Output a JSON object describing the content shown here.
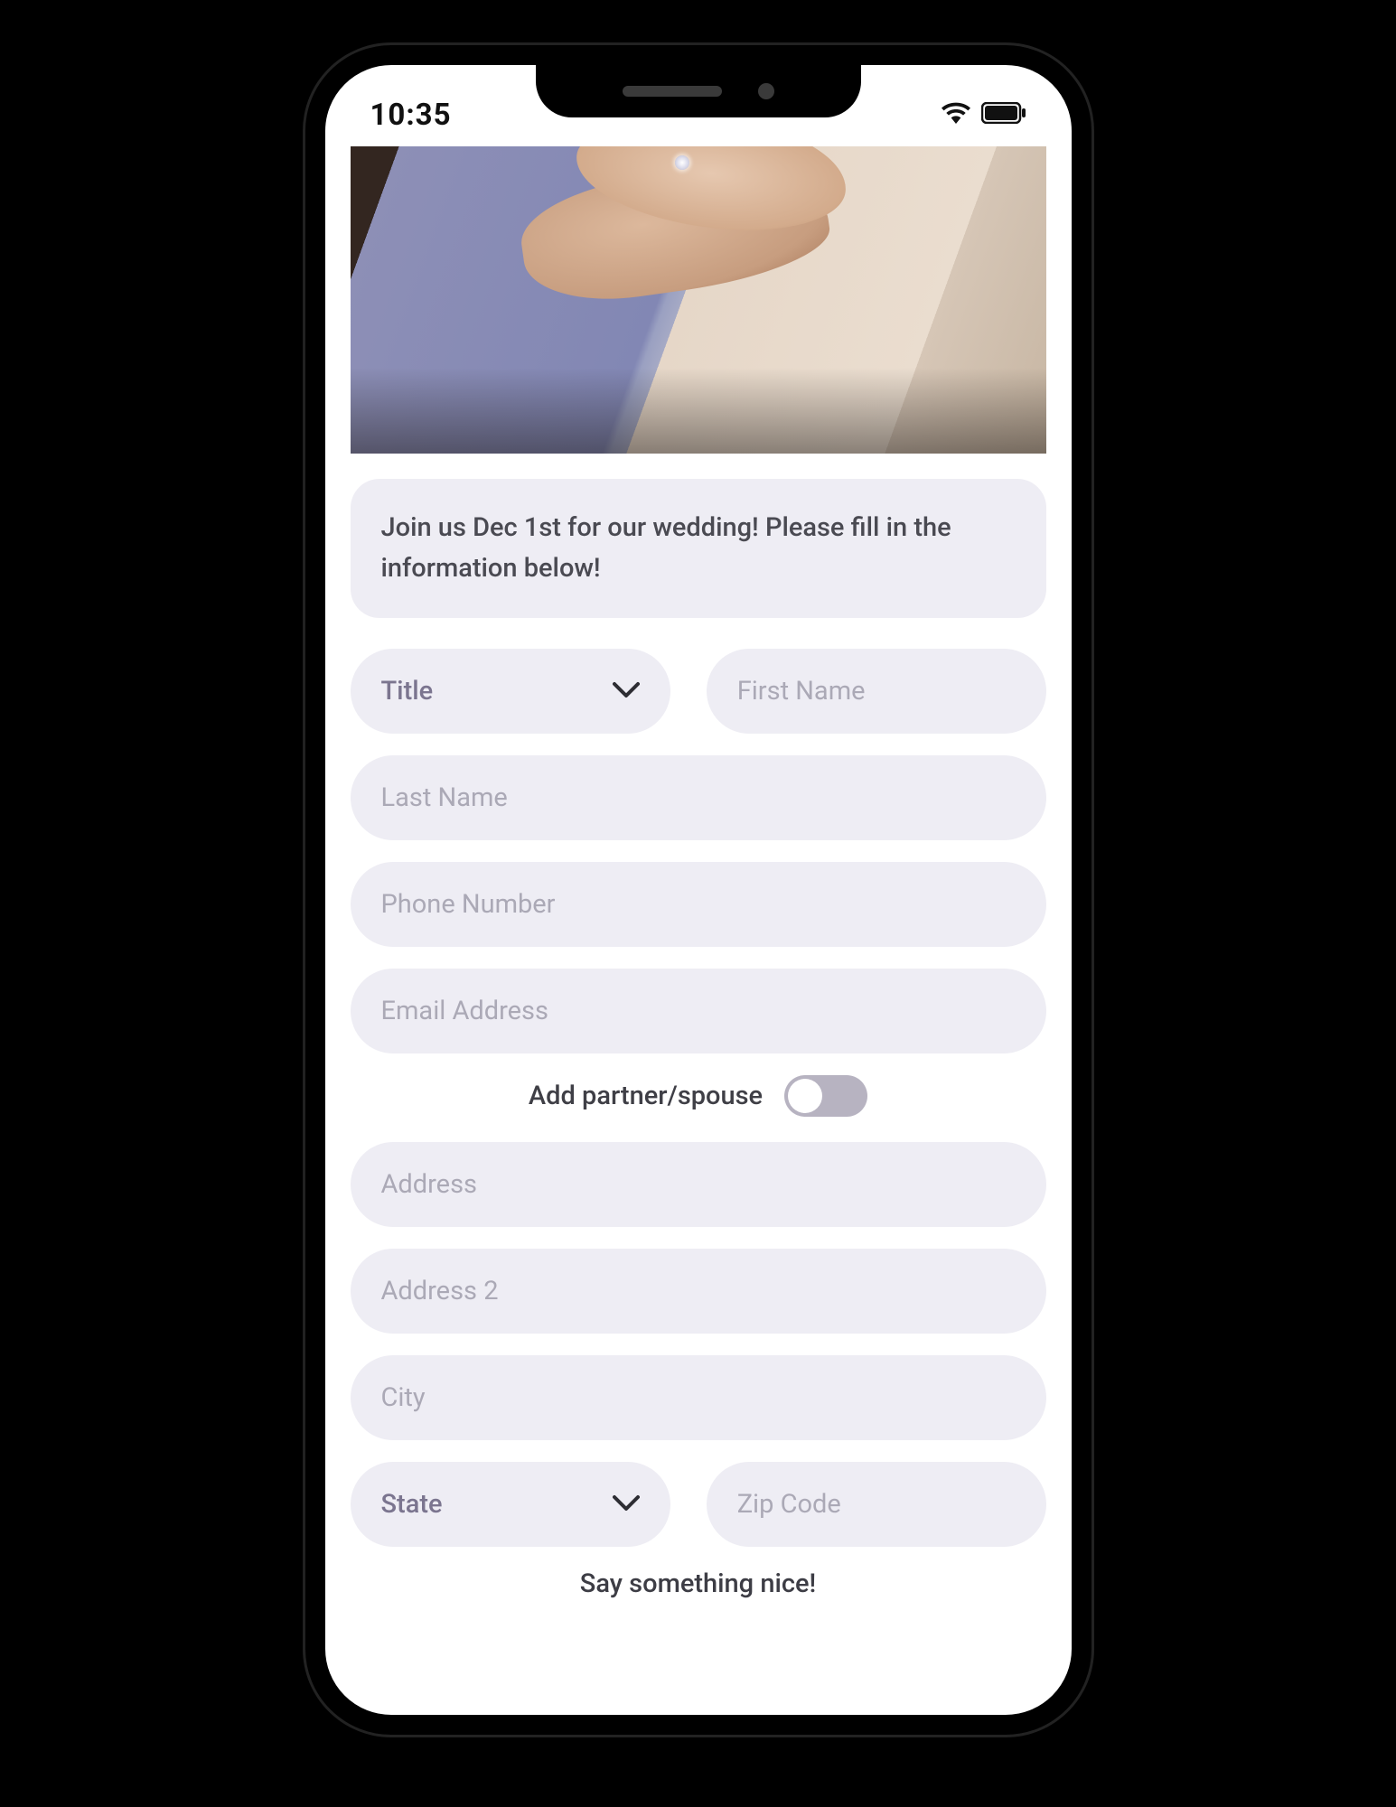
{
  "status": {
    "time": "10:35",
    "wifi_icon": "wifi-icon",
    "battery_icon": "battery-icon"
  },
  "hero": {
    "alt": "couple-holding-hands-ring"
  },
  "banner": {
    "text": "Join us Dec 1st for our wedding! Please fill in the information below!"
  },
  "form": {
    "title_select": {
      "label": "Title"
    },
    "first_name": {
      "placeholder": "First Name",
      "value": ""
    },
    "last_name": {
      "placeholder": "Last Name",
      "value": ""
    },
    "phone": {
      "placeholder": "Phone Number",
      "value": ""
    },
    "email": {
      "placeholder": "Email Address",
      "value": ""
    },
    "add_partner": {
      "label": "Add partner/spouse",
      "enabled": false
    },
    "address": {
      "placeholder": "Address",
      "value": ""
    },
    "address2": {
      "placeholder": "Address 2",
      "value": ""
    },
    "city": {
      "placeholder": "City",
      "value": ""
    },
    "state_select": {
      "label": "State"
    },
    "zip": {
      "placeholder": "Zip Code",
      "value": ""
    }
  },
  "footer": {
    "prompt": "Say something nice!"
  }
}
